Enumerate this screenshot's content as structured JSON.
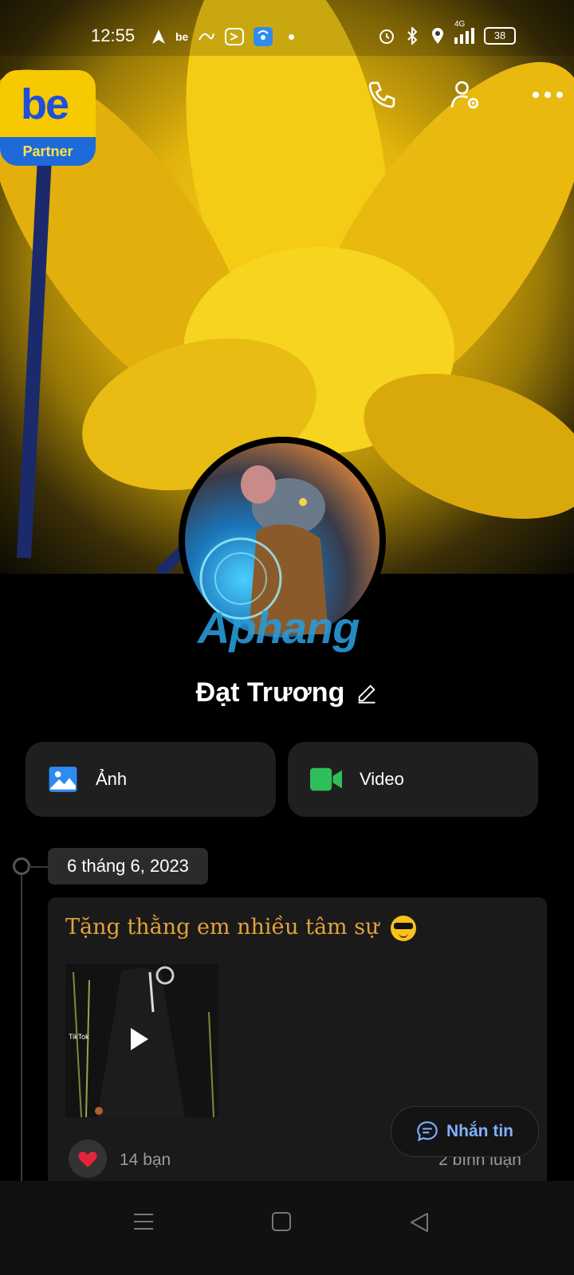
{
  "status_bar": {
    "time": "12:55",
    "network": "4G",
    "battery": "38",
    "left_icons": [
      "navigation-icon",
      "be-notification-icon",
      "app-notification-icon",
      "zalo-notification-icon",
      "wifi-hotspot-icon",
      "dot-icon"
    ],
    "right_icons": [
      "alarm-icon",
      "bluetooth-icon",
      "location-icon",
      "signal-icon",
      "battery-icon"
    ]
  },
  "floating_app": {
    "logo": "be",
    "label": "Partner"
  },
  "header_actions": [
    "phone-icon",
    "user-settings-icon",
    "more-icon"
  ],
  "profile": {
    "name": "Đạt Trương",
    "watermark": "Aphang"
  },
  "media_tabs": [
    {
      "label": "Ảnh",
      "icon": "photo-icon"
    },
    {
      "label": "Video",
      "icon": "video-icon"
    }
  ],
  "timeline": {
    "date": "6 tháng 6, 2023",
    "post": {
      "text": "Tặng thằng em nhiều tâm sự",
      "video_watermark": "TikTok",
      "likes": "14 bạn",
      "comments": "2 bình luận"
    }
  },
  "message_button": {
    "label": "Nhắn tin"
  },
  "colors": {
    "background": "#000000",
    "card": "#1f1f1f",
    "post_text": "#e3a23b",
    "accent_blue": "#7fb1ff",
    "video_green": "#2fbf5a",
    "photo_blue": "#2d8cf0"
  }
}
